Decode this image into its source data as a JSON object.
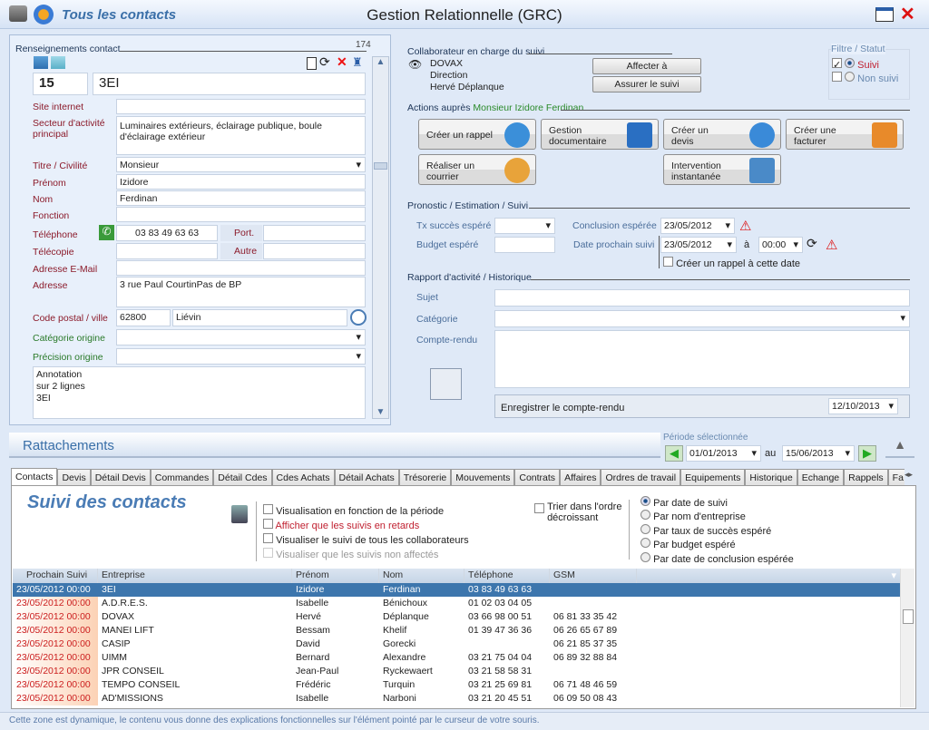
{
  "window": {
    "app_title": "Tous les contacts",
    "title": "Gestion Relationnelle (GRC)"
  },
  "contact": {
    "section": "Renseignements contact",
    "count": "174",
    "code": "15",
    "company": "3EI",
    "fields": {
      "site_label": "Site internet",
      "site": "",
      "secteur_label": "Secteur d'activité principal",
      "secteur": "Luminaires extérieurs, éclairage publique, boule d'éclairage extérieur",
      "titre_label": "Titre / Civilité",
      "titre": "Monsieur",
      "prenom_label": "Prénom",
      "prenom": "Izidore",
      "nom_label": "Nom",
      "nom": "Ferdinan",
      "fonction_label": "Fonction",
      "fonction": "",
      "tel_label": "Téléphone",
      "tel": "03 83 49 63 63",
      "port_label": "Port.",
      "port": "",
      "fax_label": "Télécopie",
      "fax": "",
      "autre_label": "Autre",
      "autre": "",
      "email_label": "Adresse E-Mail",
      "email": "",
      "adresse_label": "Adresse",
      "adresse": "3 rue Paul CourtinPas de BP",
      "cp_label": "Code postal / ville",
      "cp": "62800",
      "ville": "Liévin",
      "cat_label": "Catégorie origine",
      "cat": "",
      "prec_label": "Précision origine",
      "prec": "",
      "annotation": "Annotation\nsur 2 lignes\n3EI"
    }
  },
  "collab": {
    "section": "Collaborateur en charge du suivi",
    "name": "DOVAX",
    "dept": "Direction",
    "person": "Hervé Déplanque",
    "affecter": "Affecter à",
    "assurer": "Assurer le suivi"
  },
  "filter": {
    "title": "Filtre / Statut",
    "suivi": "Suivi",
    "non_suivi": "Non suivi"
  },
  "actions": {
    "prefix": "Actions auprès",
    "target": "Monsieur Izidore Ferdinan",
    "b1": "Créer un rappel",
    "b2": "Gestion\ndocumentaire",
    "b3": "Créer un\ndevis",
    "b4": "Créer une\nfacturer",
    "b5": "Réaliser un\ncourrier",
    "b6": "Intervention\ninstantanée"
  },
  "prono": {
    "section": "Pronostic / Estimation / Suivi",
    "tx_label": "Tx succès espéré",
    "tx": "",
    "budget_label": "Budget espéré",
    "budget": "",
    "concl_label": "Conclusion espérée",
    "concl": "23/05/2012",
    "next_label": "Date prochain suivi",
    "next": "23/05/2012",
    "a": "à",
    "time": "00:00",
    "rappel": "Créer un rappel à cette date"
  },
  "rapport": {
    "section": "Rapport d'activité / Historique",
    "sujet_label": "Sujet",
    "sujet": "",
    "cat_label": "Catégorie",
    "cat": "",
    "cr_label": "Compte-rendu",
    "cr": "",
    "save": "Enregistrer le compte-rendu",
    "date": "12/10/2013"
  },
  "rattach": {
    "title": "Rattachements",
    "periode": "Période sélectionnée",
    "from": "01/01/2013",
    "au": "au",
    "to": "15/06/2013"
  },
  "tabs": [
    "Contacts",
    "Devis",
    "Détail Devis",
    "Commandes",
    "Détail Cdes",
    "Cdes Achats",
    "Détail Achats",
    "Trésorerie",
    "Mouvements",
    "Contrats",
    "Affaires",
    "Ordres de travail",
    "Equipements",
    "Historique",
    "Echange",
    "Rappels",
    "Fa"
  ],
  "suivi": {
    "title": "Suivi des contacts",
    "checks": [
      "Visualisation en fonction de la période",
      "Afficher que les suivis en retards",
      "Visualiser le suivi de tous les collaborateurs",
      "Visualiser que les suivis non affectés"
    ],
    "trier": "Trier dans l'ordre\ndécroissant",
    "sorts": [
      "Par date de suivi",
      "Par nom d'entreprise",
      "Par taux de succès espéré",
      "Par budget espéré",
      "Par date de conclusion espérée"
    ]
  },
  "table": {
    "columns": [
      "Prochain Suivi",
      "Entreprise",
      "Prénom",
      "Nom",
      "Téléphone",
      "GSM"
    ],
    "rows": [
      [
        "23/05/2012  00:00",
        "3EI",
        "Izidore",
        "Ferdinan",
        "03 83 49 63 63",
        ""
      ],
      [
        "23/05/2012  00:00",
        "A.D.R.E.S.",
        "Isabelle",
        "Bénichoux",
        "01 02 03 04 05",
        ""
      ],
      [
        "23/05/2012  00:00",
        "DOVAX",
        "Hervé",
        "Déplanque",
        "03 66 98 00 51",
        "06 81 33 35 42"
      ],
      [
        "23/05/2012  00:00",
        "MANEI LIFT",
        "Bessam",
        "Khelif",
        "01 39 47 36 36",
        "06 26 65 67 89"
      ],
      [
        "23/05/2012  00:00",
        "CASIP",
        "David",
        "Gorecki",
        "",
        "06 21 85 37 35"
      ],
      [
        "23/05/2012  00:00",
        "UIMM",
        "Bernard",
        "Alexandre",
        "03 21 75 04 04",
        "06 89 32 88 84"
      ],
      [
        "23/05/2012  00:00",
        "JPR CONSEIL",
        "Jean-Paul",
        "Ryckewaert",
        "03 21 58 58 31",
        ""
      ],
      [
        "23/05/2012  00:00",
        "TEMPO CONSEIL",
        "Frédéric",
        "Turquin",
        "03 21 25 69 81",
        "06 71 48 46 59"
      ],
      [
        "23/05/2012  00:00",
        "AD'MISSIONS",
        "Isabelle",
        "Narboni",
        "03 21 20 45 51",
        "06 09 50 08 43"
      ]
    ]
  },
  "status": "Cette zone est dynamique, le contenu vous donne des explications fonctionnelles sur l'élément pointé par le curseur de votre souris."
}
